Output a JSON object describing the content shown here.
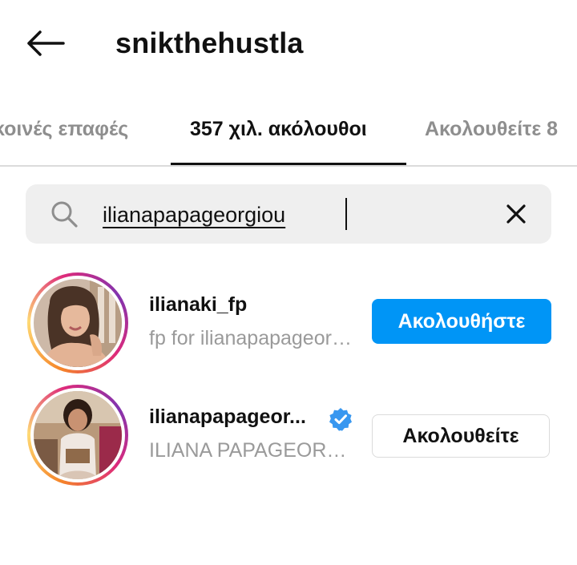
{
  "header": {
    "back_icon": "arrow-left-icon",
    "title": "snikthehustla"
  },
  "tabs": [
    {
      "label": "κοινές επαφές",
      "active": false
    },
    {
      "label": "357 χιλ. ακόλουθοι",
      "active": true
    },
    {
      "label": "Ακολουθείτε 8",
      "active": false
    }
  ],
  "search": {
    "icon": "search-icon",
    "value": "ilianapapageorgiou",
    "placeholder": "",
    "clear_icon": "close-icon"
  },
  "results": [
    {
      "username": "ilianaki_fp",
      "full_name": "fp for ilianapapageorgiou",
      "verified": false,
      "action_label": "Ακολουθήστε"
    },
    {
      "username": "ilianapapageor...",
      "full_name": "ILIANA PAPAGEORGIOU",
      "verified": true,
      "action_label": "Ακολουθείτε"
    }
  ],
  "colors": {
    "accent": "#0095f6",
    "secondary_text": "#9a9a9a",
    "divider": "#dbdbdb",
    "search_bg": "#efefef"
  }
}
